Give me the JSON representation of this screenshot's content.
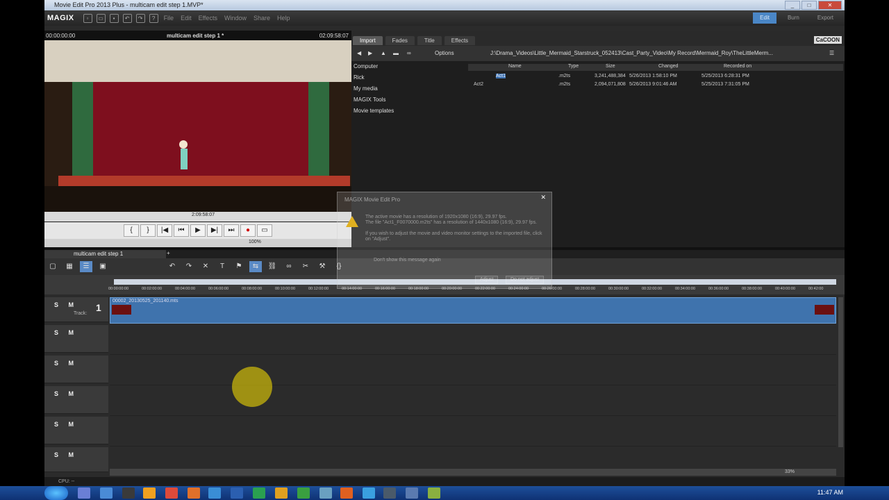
{
  "window": {
    "title": "Movie Edit Pro 2013 Plus - multicam edit step 1.MVP*"
  },
  "menubar": {
    "logo": "MAGIX",
    "items": [
      "File",
      "Edit",
      "Effects",
      "Window",
      "Share",
      "Help"
    ],
    "modes": [
      "Edit",
      "Burn",
      "Export"
    ],
    "active_mode": "Edit"
  },
  "monitor": {
    "left_time": "00:00:00:00",
    "title": "multicam edit step 1 *",
    "right_time": "02:09:58:07",
    "scrub_time": "2:09:58:07",
    "zoom": "100%"
  },
  "media": {
    "tabs": [
      "Import",
      "Fades",
      "Title",
      "Effects"
    ],
    "active_tab": "Import",
    "brand": "CaCOON",
    "options_label": "Options",
    "path": "J:\\Drama_Videos\\Little_Mermaid_Starstruck_052413\\Cast_Party_Video\\My Record\\Mermaid_Roy\\TheLittleMerm...",
    "tree": [
      "Computer",
      "Rick",
      "My media",
      "MAGIX Tools",
      "Movie templates"
    ],
    "columns": [
      "Name",
      "Type",
      "Size",
      "Changed",
      "Recorded on"
    ],
    "files": [
      {
        "name": "Act1",
        "type": ".m2ts",
        "size": "3,241,488,384",
        "changed": "5/26/2013 1:58:10 PM",
        "recorded": "5/25/2013 6:28:31 PM"
      },
      {
        "name": "Act2",
        "type": ".m2ts",
        "size": "2,094,071,808",
        "changed": "5/26/2013 9:01:46 AM",
        "recorded": "5/25/2013 7:31:05 PM"
      }
    ]
  },
  "timeline": {
    "tab": "multicam edit step 1",
    "ruler_ticks": [
      "00:00:00:00",
      "00:02:00:00",
      "00:04:00:00",
      "00:06:00:00",
      "00:08:00:00",
      "00:10:00:00",
      "00:12:00:00",
      "00:14:00:00",
      "00:16:00:00",
      "00:18:00:00",
      "00:20:00:00",
      "00:22:00:00",
      "00:24:00:00",
      "00:26:00:00",
      "00:28:00:00",
      "00:30:00:00",
      "00:32:00:00",
      "00:34:00:00",
      "00:36:00:00",
      "00:38:00:00",
      "00:40:00:00",
      "00:42:00"
    ],
    "track_buttons": "S M",
    "track_label": "Track:",
    "track1_number": "1",
    "clip_name": "00002_20130525_201140.mts",
    "zoom": "33%"
  },
  "dialog": {
    "title": "MAGIX Movie Edit Pro",
    "line1": "The active movie has a resolution of 1920x1080 (16:9), 29.97 fps.",
    "line2": "The file \"Act1_F0070000.m2ts\" has a resolution of 1440x1080 (16:9), 29.97 fps.",
    "line3": "If you wish to adjust the movie and video monitor settings to the imported file, click on \"Adjust\".",
    "checkbox": "Don't show this message again",
    "adjust": "Adjust",
    "dont_adjust": "Do not adjust"
  },
  "status": {
    "cpu": "CPU: --"
  },
  "taskbar": {
    "clock": "11:47 AM"
  }
}
